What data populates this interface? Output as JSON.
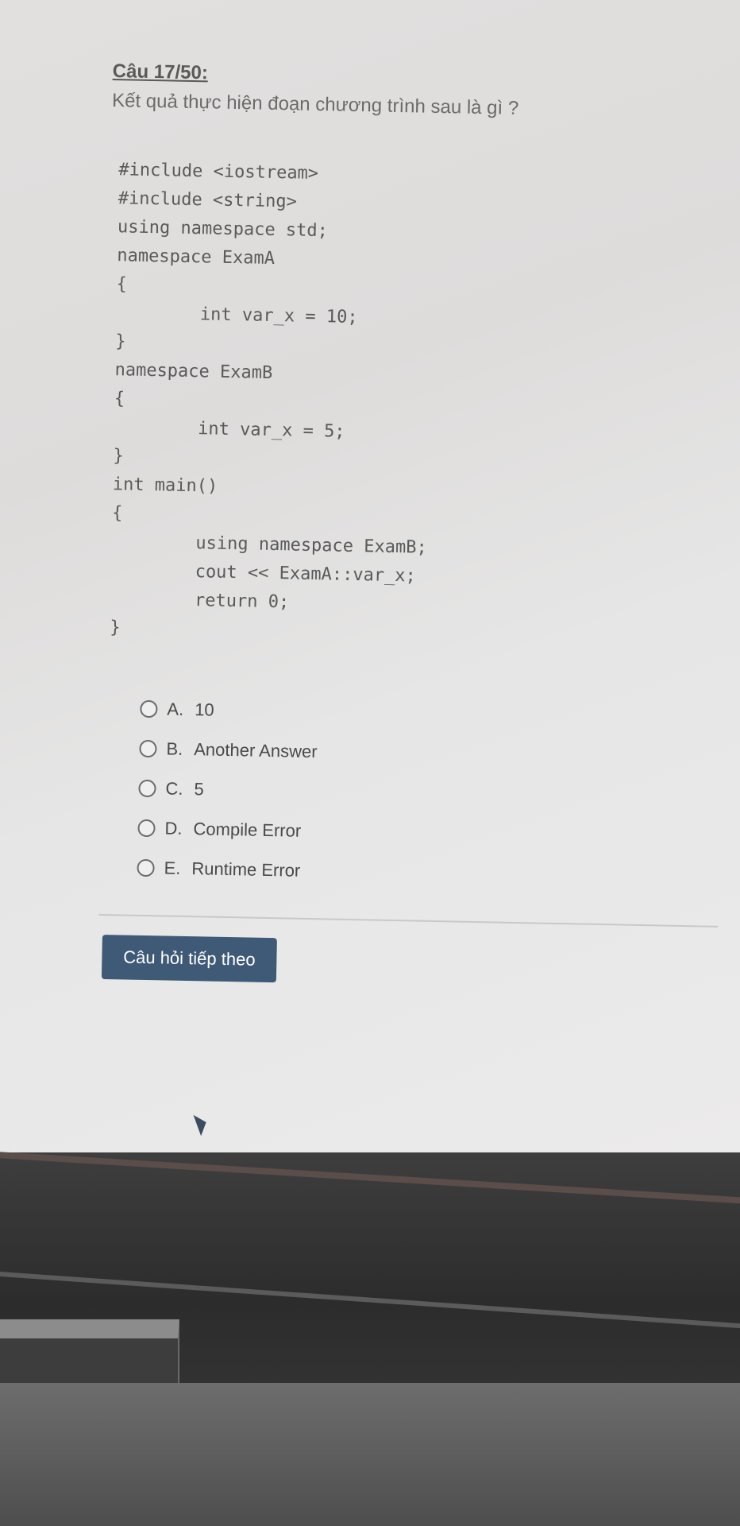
{
  "question": {
    "title": "Câu 17/50:",
    "text": "Kết quả thực hiện đoạn chương trình sau là gì ?"
  },
  "code": {
    "lines": [
      "#include <iostream>",
      "#include <string>",
      "using namespace std;",
      "namespace ExamA",
      "{",
      "        int var_x = 10;",
      "}",
      "namespace ExamB",
      "{",
      "        int var_x = 5;",
      "}",
      "int main()",
      "{",
      "        using namespace ExamB;",
      "        cout << ExamA::var_x;",
      "        return 0;",
      "}"
    ]
  },
  "options": [
    {
      "letter": "A.",
      "text": "10"
    },
    {
      "letter": "B.",
      "text": "Another Answer"
    },
    {
      "letter": "C.",
      "text": "5"
    },
    {
      "letter": "D.",
      "text": "Compile Error"
    },
    {
      "letter": "E.",
      "text": "Runtime Error"
    }
  ],
  "next_button": {
    "label": "Câu hỏi tiếp theo"
  },
  "colors": {
    "button_bg": "#3e5a77",
    "text": "#5a5a5a"
  }
}
